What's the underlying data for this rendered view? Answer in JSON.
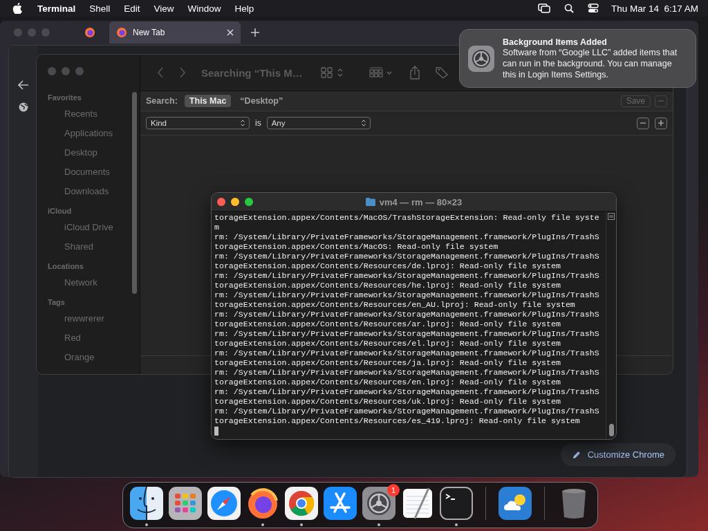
{
  "menu_bar": {
    "app_name": "Terminal",
    "menus": [
      "Shell",
      "Edit",
      "View",
      "Window",
      "Help"
    ],
    "clock": "Thu Mar 14  6:17 AM"
  },
  "browser": {
    "tabs": [
      {
        "kind": "pinned",
        "selected": false
      },
      {
        "kind": "labeled",
        "label": "New Tab",
        "selected": true
      }
    ]
  },
  "chrome": {
    "customize_button": "Customize Chrome"
  },
  "finder": {
    "title": "Searching “This M…",
    "search_label": "Search:",
    "scopes": [
      {
        "label": "This Mac",
        "selected": true
      },
      {
        "label": "“Desktop”",
        "selected": false
      }
    ],
    "save_button": "Save",
    "criteria": {
      "attribute": "Kind",
      "operator": "is",
      "value": "Any"
    },
    "sidebar": [
      {
        "heading": "Favorites",
        "items": [
          "Recents",
          "Applications",
          "Desktop",
          "Documents",
          "Downloads"
        ]
      },
      {
        "heading": "iCloud",
        "items": [
          "iCloud Drive",
          "Shared"
        ]
      },
      {
        "heading": "Locations",
        "items": [
          "Network"
        ]
      },
      {
        "heading": "Tags",
        "items": [
          "rewwrerer",
          "Red",
          "Orange"
        ]
      }
    ]
  },
  "terminal": {
    "title": "vm4 — rm — 80×23",
    "lines": [
      "torageExtension.appex/Contents/MacOS/TrashStorageExtension: Read-only file syste",
      "m",
      "rm: /System/Library/PrivateFrameworks/StorageManagement.framework/PlugIns/TrashS",
      "torageExtension.appex/Contents/MacOS: Read-only file system",
      "rm: /System/Library/PrivateFrameworks/StorageManagement.framework/PlugIns/TrashS",
      "torageExtension.appex/Contents/Resources/de.lproj: Read-only file system",
      "rm: /System/Library/PrivateFrameworks/StorageManagement.framework/PlugIns/TrashS",
      "torageExtension.appex/Contents/Resources/he.lproj: Read-only file system",
      "rm: /System/Library/PrivateFrameworks/StorageManagement.framework/PlugIns/TrashS",
      "torageExtension.appex/Contents/Resources/en_AU.lproj: Read-only file system",
      "rm: /System/Library/PrivateFrameworks/StorageManagement.framework/PlugIns/TrashS",
      "torageExtension.appex/Contents/Resources/ar.lproj: Read-only file system",
      "rm: /System/Library/PrivateFrameworks/StorageManagement.framework/PlugIns/TrashS",
      "torageExtension.appex/Contents/Resources/el.lproj: Read-only file system",
      "rm: /System/Library/PrivateFrameworks/StorageManagement.framework/PlugIns/TrashS",
      "torageExtension.appex/Contents/Resources/ja.lproj: Read-only file system",
      "rm: /System/Library/PrivateFrameworks/StorageManagement.framework/PlugIns/TrashS",
      "torageExtension.appex/Contents/Resources/en.lproj: Read-only file system",
      "rm: /System/Library/PrivateFrameworks/StorageManagement.framework/PlugIns/TrashS",
      "torageExtension.appex/Contents/Resources/uk.lproj: Read-only file system",
      "rm: /System/Library/PrivateFrameworks/StorageManagement.framework/PlugIns/TrashS",
      "torageExtension.appex/Contents/Resources/es_419.lproj: Read-only file system"
    ]
  },
  "notification": {
    "title": "Background Items Added",
    "body": "Software from “Google LLC” added items that can run in the background. You can manage this in Login Items Settings."
  },
  "dock": {
    "items": [
      {
        "kind": "finder",
        "running": true
      },
      {
        "kind": "launchpad",
        "running": false
      },
      {
        "kind": "safari",
        "running": false
      },
      {
        "kind": "firefox",
        "running": true
      },
      {
        "kind": "chrome",
        "running": true
      },
      {
        "kind": "appstore",
        "running": false
      },
      {
        "kind": "settings",
        "running": true,
        "badge": "1"
      },
      {
        "kind": "textedit",
        "running": false
      },
      {
        "kind": "terminal",
        "running": true
      },
      {
        "kind": "separator"
      },
      {
        "kind": "weather",
        "running": false
      },
      {
        "kind": "separator"
      },
      {
        "kind": "trash",
        "running": false
      }
    ]
  }
}
